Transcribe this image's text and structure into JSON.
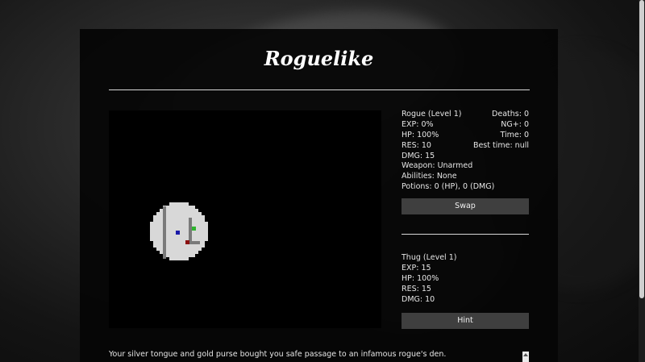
{
  "title": "Roguelike",
  "player": {
    "name_level": "Rogue (Level 1)",
    "exp": "EXP: 0%",
    "hp": "HP: 100%",
    "res": "RES: 10",
    "dmg": "DMG: 15",
    "weapon": "Weapon: Unarmed",
    "abilities": "Abilities: None",
    "potions": "Potions: 0 (HP), 0 (DMG)"
  },
  "meta": {
    "deaths": "Deaths: 0",
    "ng_plus": "NG+: 0",
    "time": "Time: 0",
    "best_time": "Best time: null"
  },
  "enemy": {
    "name_level": "Thug (Level 1)",
    "exp": "EXP: 15",
    "hp": "HP: 100%",
    "res": "RES: 15",
    "dmg": "DMG: 10"
  },
  "buttons": {
    "swap": "Swap",
    "hint": "Hint"
  },
  "message": "Your silver tongue and gold purse bought you safe passage to an infamous rogue's den.",
  "colors": {
    "player_marker": "#1a1aa8",
    "enemy_marker": "#8b1010",
    "item_marker": "#2fb52f",
    "floor": "#d8d8d8",
    "wall": "#7a7a7a"
  }
}
